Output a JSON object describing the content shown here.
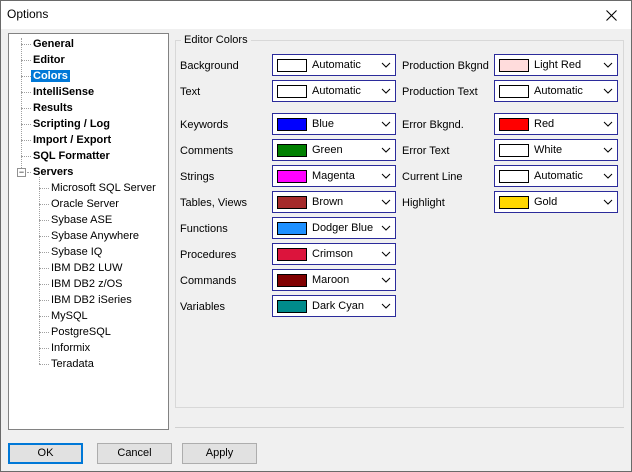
{
  "window": {
    "title": "Options"
  },
  "tree": [
    {
      "label": "General"
    },
    {
      "label": "Editor"
    },
    {
      "label": "Colors"
    },
    {
      "label": "IntelliSense"
    },
    {
      "label": "Results"
    },
    {
      "label": "Scripting / Log"
    },
    {
      "label": "Import / Export"
    },
    {
      "label": "SQL Formatter"
    },
    {
      "label": "Servers",
      "expander": "−"
    },
    {
      "label": "Microsoft SQL Server"
    },
    {
      "label": "Oracle Server"
    },
    {
      "label": "Sybase ASE"
    },
    {
      "label": "Sybase Anywhere"
    },
    {
      "label": "Sybase IQ"
    },
    {
      "label": "IBM DB2 LUW"
    },
    {
      "label": "IBM DB2 z/OS"
    },
    {
      "label": "IBM DB2 iSeries"
    },
    {
      "label": "MySQL"
    },
    {
      "label": "PostgreSQL"
    },
    {
      "label": "Informix"
    },
    {
      "label": "Teradata"
    }
  ],
  "editor_colors": {
    "title": "Editor Colors",
    "left": [
      {
        "label": "Background",
        "value": "Automatic",
        "color": "#ffffff"
      },
      {
        "label": "Text",
        "value": "Automatic",
        "color": "#ffffff"
      },
      {
        "label": "Keywords",
        "value": "Blue",
        "color": "#0000ff"
      },
      {
        "label": "Comments",
        "value": "Green",
        "color": "#008000"
      },
      {
        "label": "Strings",
        "value": "Magenta",
        "color": "#ff00ff"
      },
      {
        "label": "Tables, Views",
        "value": "Brown",
        "color": "#a52a2a"
      },
      {
        "label": "Functions",
        "value": "Dodger Blue",
        "color": "#1e90ff"
      },
      {
        "label": "Procedures",
        "value": "Crimson",
        "color": "#dc143c"
      },
      {
        "label": "Commands",
        "value": "Maroon",
        "color": "#800000"
      },
      {
        "label": "Variables",
        "value": "Dark Cyan",
        "color": "#008b8b"
      }
    ],
    "right": [
      {
        "label": "Production Bkgnd",
        "value": "Light Red",
        "color": "#ffdcdc"
      },
      {
        "label": "Production Text",
        "value": "Automatic",
        "color": "#ffffff"
      },
      {
        "label": "Error Bkgnd.",
        "value": "Red",
        "color": "#ff0000"
      },
      {
        "label": "Error Text",
        "value": "White",
        "color": "#ffffff"
      },
      {
        "label": "Current Line",
        "value": "Automatic",
        "color": "#ffffff"
      },
      {
        "label": "Highlight",
        "value": "Gold",
        "color": "#ffd700"
      }
    ]
  },
  "buttons": {
    "ok": "OK",
    "cancel": "Cancel",
    "apply": "Apply"
  }
}
